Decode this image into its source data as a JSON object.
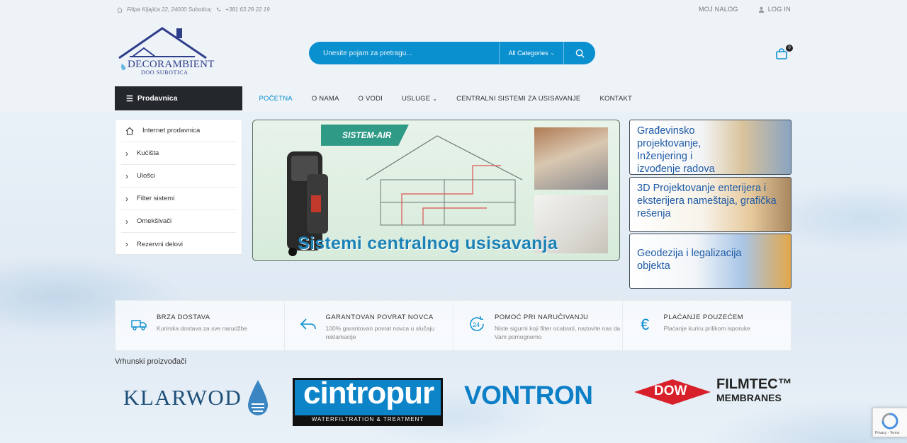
{
  "topbar": {
    "address": "Filipa Kljajića 22, 24000 Subotica;",
    "phone": "+381 63 29 22 19",
    "my_account": "MOJ NALOG",
    "login": "LOG IN"
  },
  "header": {
    "logo_name": "DECORAMBIENT",
    "logo_sub": "DOO SUBOTICA",
    "search_placeholder": "Unesite pojam za pretragu...",
    "category_select": "All Categories",
    "cart_count": "0"
  },
  "nav": {
    "shop_button": "Prodavnica",
    "items": [
      "POČETNA",
      "O NAMA",
      "O VODI",
      "USLUGE",
      "CENTRALNI SISTEMI ZA USISAVANJE",
      "KONTAKT"
    ]
  },
  "categories": [
    "Internet prodavnica",
    "Kućišta",
    "Ulošci",
    "Filter sistemi",
    "Omekšivači",
    "Rezervni delovi"
  ],
  "main_banner": {
    "brand": "SISTEM-AIR",
    "title": "Sistemi centralnog usisavanja"
  },
  "side_banners": [
    {
      "text": "Građevinsko projektovanje, Inženjering i izvođenje radova"
    },
    {
      "text": "3D Projektovanje enterijera i eksterijera nameštaja, grafička rešenja"
    },
    {
      "text": "Geodezija i legalizacija objekta"
    }
  ],
  "features": [
    {
      "icon": "truck-icon",
      "title": "BRZA DOSTAVA",
      "text": "Kurirska dostava za sve narudžbe"
    },
    {
      "icon": "return-arrow-icon",
      "title": "GARANTOVAN POVRAT NOVCA",
      "text": "100% garantovan povrat novca u slučaju reklamacije"
    },
    {
      "icon": "support-24-icon",
      "title": "POMOĆ PRI NARUČIVANJU",
      "text": "Niste sigurni koji filter ocabrati, nazovite nas da Vam pomognemo"
    },
    {
      "icon": "euro-icon",
      "title": "PLAĆANJE POUZEĆEM",
      "text": "Plaćanje kuriru prilikom isporuke"
    }
  ],
  "brands": {
    "title": "Vrhunski proizvođači",
    "klarwod": "KLARWOD",
    "cintropur": "cintropur",
    "cintropur_tagline": "WATERFILTRATION & TREATMENT",
    "vontron": "VONTRON",
    "dow": "DOW",
    "filmtec": "FILMTEC™",
    "filmtec_sub": "MEMBRANES"
  },
  "recaptcha": "Privacy - Terms",
  "colors": {
    "accent": "#0a8fcf",
    "dark": "#24272c",
    "logo": "#2e3e8a"
  }
}
